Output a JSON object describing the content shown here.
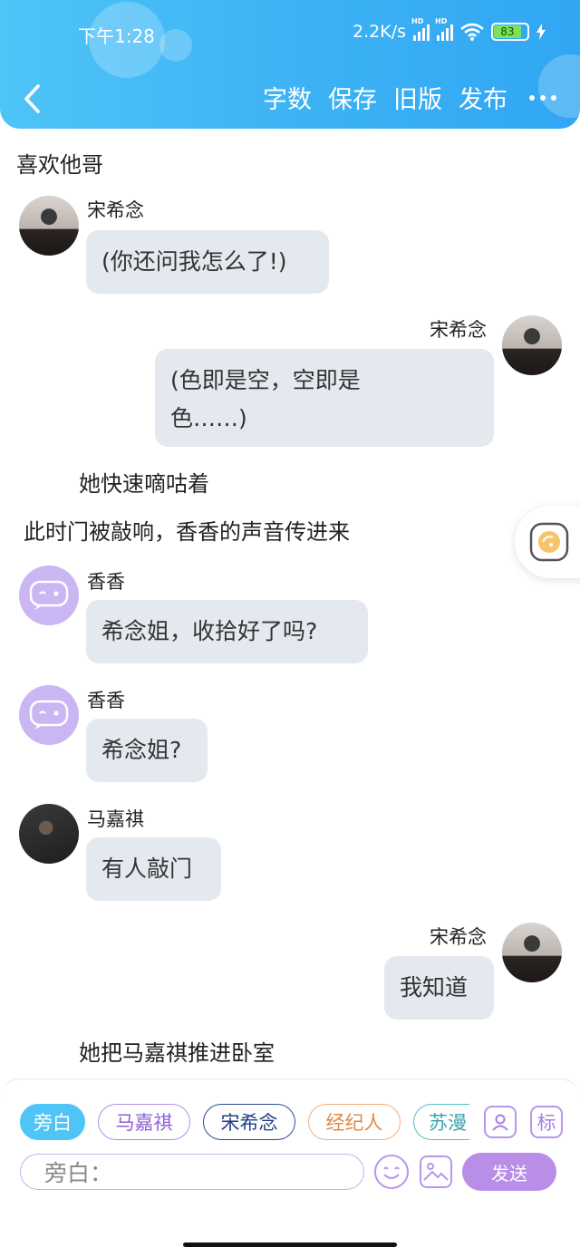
{
  "status": {
    "time": "下午1:28",
    "speed": "2.2K/s",
    "battery": "83"
  },
  "toolbar": {
    "word_count": "字数",
    "save": "保存",
    "old_version": "旧版",
    "publish": "发布"
  },
  "chat": {
    "title_line": "喜欢他哥",
    "m1": {
      "name": "宋希念",
      "text": "(你还问我怎么了!)"
    },
    "m2": {
      "name": "宋希念",
      "text1": "(色即是空，空即是",
      "text2": "色……)"
    },
    "narr1": "她快速嘀咕着",
    "narr2": "此时门被敲响，香香的声音传进来",
    "m3": {
      "name": "香香",
      "text": "希念姐，收拾好了吗?"
    },
    "m4": {
      "name": "香香",
      "text": "希念姐?"
    },
    "m5": {
      "name": "马嘉祺",
      "text": "有人敲门"
    },
    "m6": {
      "name": "宋希念",
      "text": "我知道"
    },
    "narr3": "她把马嘉祺推进卧室"
  },
  "chips": {
    "narrator": "旁白",
    "c1": "马嘉祺",
    "c2": "宋希念",
    "c3": "经纪人",
    "c4": "苏漫"
  },
  "tools": {
    "tag": "标"
  },
  "input": {
    "prefix": "旁白："
  },
  "send": "发送",
  "colors": {
    "header": "#3db3f5",
    "bubble": "#e4e8ef",
    "accent_purple": "#b88ee8"
  },
  "icons": [
    "back-icon",
    "more-icon",
    "wifi-icon",
    "signal-icon",
    "battery-icon",
    "emoji-icon",
    "image-icon",
    "role-icon",
    "tag-icon",
    "stamp-icon"
  ]
}
